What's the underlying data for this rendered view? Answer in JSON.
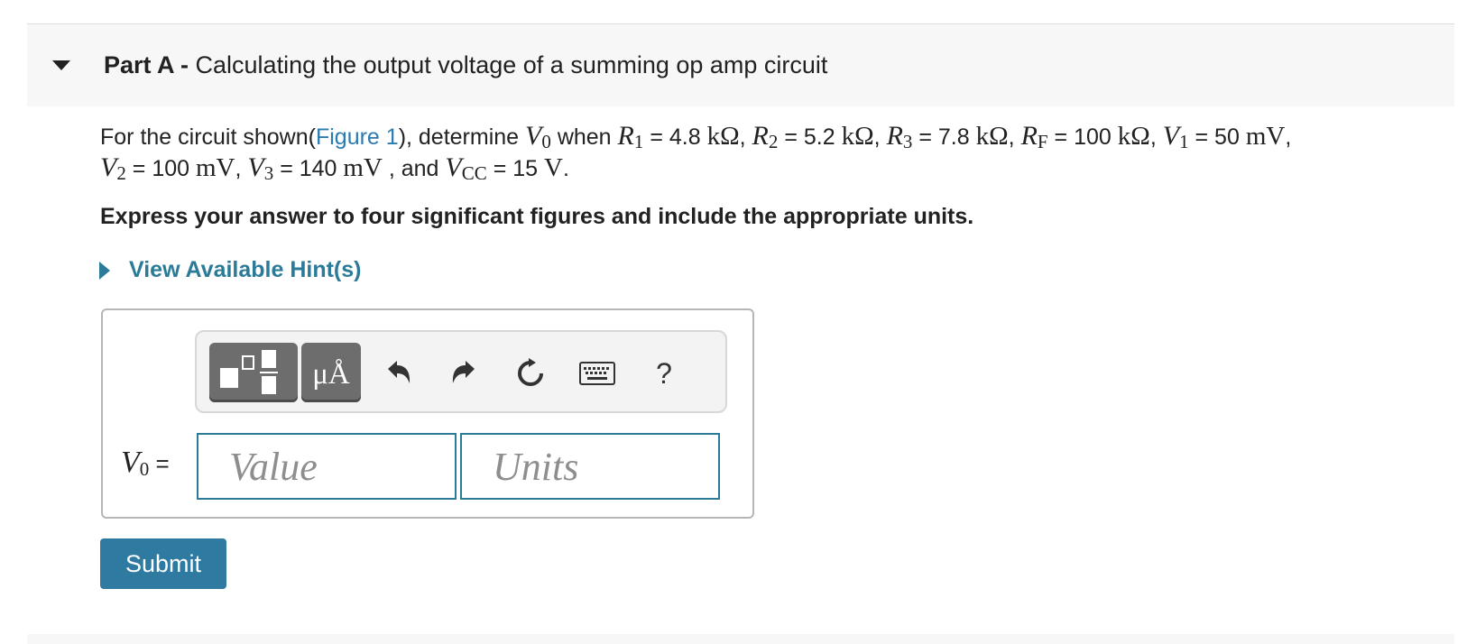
{
  "part": {
    "prefix": "Part A -",
    "title": "Calculating the output voltage of a summing op amp circuit"
  },
  "question": {
    "intro": "For the circuit shown(",
    "figure_link": "Figure 1",
    "after_link": "), determine",
    "vo_var": "V",
    "vo_sub": "0",
    "when": "when",
    "r1_var": "R",
    "r1_sub": "1",
    "r1_val": "= 4.8",
    "r1_unit": "kΩ",
    "r2_var": "R",
    "r2_sub": "2",
    "r2_val": "= 5.2",
    "r2_unit": "kΩ",
    "r3_var": "R",
    "r3_sub": "3",
    "r3_val": "= 7.8",
    "r3_unit": "kΩ",
    "rf_var": "R",
    "rf_sub": "F",
    "rf_val": "= 100",
    "rf_unit": "kΩ",
    "v1_var": "V",
    "v1_sub": "1",
    "v1_val": "= 50",
    "v1_unit": "mV",
    "v2_var": "V",
    "v2_sub": "2",
    "v2_val": "= 100",
    "v2_unit": "mV",
    "v3_var": "V",
    "v3_sub": "3",
    "v3_val": "= 140",
    "v3_unit": "mV",
    "and": ", and",
    "vcc_var": "V",
    "vcc_sub": "CC",
    "vcc_val": "= 15",
    "vcc_unit": "V",
    "sep": ","
  },
  "instruction": "Express your answer to four significant figures and include the appropriate units.",
  "hint_label": "View Available Hint(s)",
  "toolbar": {
    "units_button": "μÅ",
    "help": "?",
    "icons": [
      "templates-icon",
      "units-icon",
      "undo-icon",
      "redo-icon",
      "reset-icon",
      "keyboard-icon",
      "help-icon"
    ]
  },
  "answer": {
    "var": "V",
    "sub": "0",
    "equals": "=",
    "value_placeholder": "Value",
    "units_placeholder": "Units"
  },
  "submit_label": "Submit"
}
